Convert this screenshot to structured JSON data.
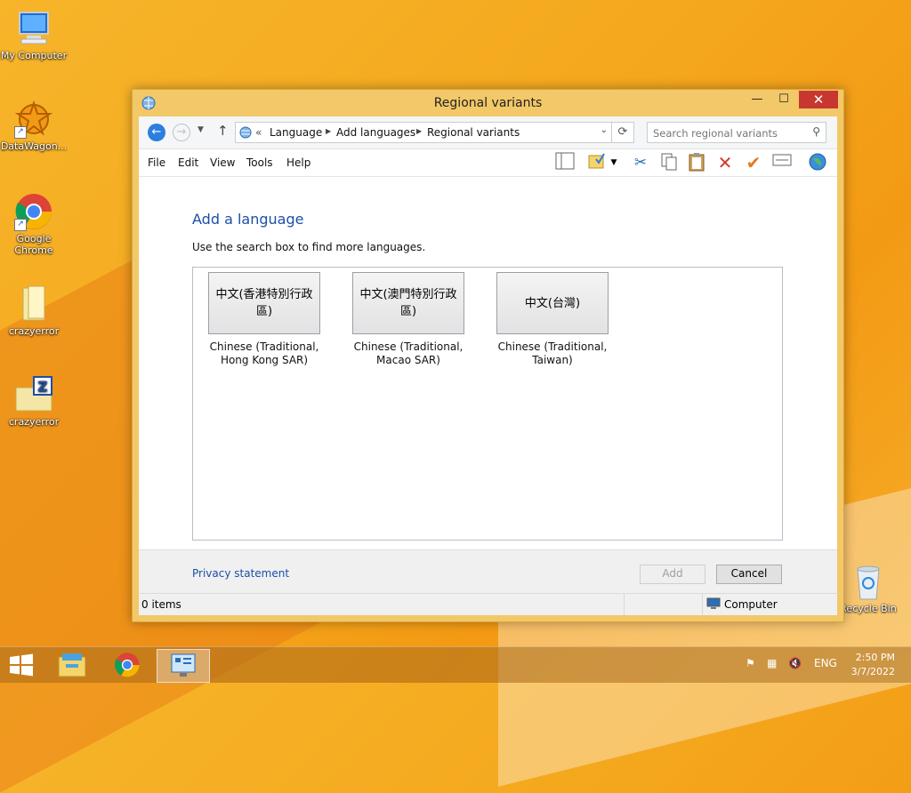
{
  "desktop": {
    "icons": [
      {
        "label": "My Computer",
        "icon": "computer-icon"
      },
      {
        "label": "DataWagon...",
        "icon": "datawagon-icon"
      },
      {
        "label": "Google Chrome",
        "icon": "chrome-icon"
      },
      {
        "label": "crazyerror",
        "icon": "folder-icon"
      },
      {
        "label": "crazyerror",
        "icon": "zip-icon"
      },
      {
        "label": "Recycle Bin",
        "icon": "recycle-bin-icon"
      }
    ]
  },
  "window": {
    "title": "Regional variants",
    "controls": {
      "minimize": "—",
      "maximize": "☐",
      "close": "✕"
    },
    "address": {
      "overflow": "«",
      "crumbs": [
        "Language",
        "Add languages",
        "Regional variants"
      ]
    },
    "search": {
      "placeholder": "Search regional variants"
    },
    "menu": [
      "File",
      "Edit",
      "View",
      "Tools",
      "Help"
    ],
    "toolbar_icons": [
      "layout-pane-icon",
      "folder-check-icon",
      "dropdown-icon",
      "cut-icon",
      "copy-icon",
      "paste-icon",
      "delete-icon",
      "checkmark-icon",
      "properties-icon",
      "globe-icon"
    ],
    "heading": "Add a language",
    "description": "Use the search box to find more languages.",
    "languages": [
      {
        "native": "中文(香港特別行政區)",
        "english": "Chinese (Traditional, Hong Kong SAR)"
      },
      {
        "native": "中文(澳門特別行政區)",
        "english": "Chinese (Traditional, Macao SAR)"
      },
      {
        "native": "中文(台灣)",
        "english": "Chinese (Traditional, Taiwan)"
      }
    ],
    "privacy_link": "Privacy statement",
    "buttons": {
      "add": "Add",
      "cancel": "Cancel"
    },
    "status": {
      "items": "0 items",
      "location": "Computer"
    }
  },
  "taskbar": {
    "apps": [
      "start-icon",
      "file-explorer-icon",
      "chrome-icon",
      "control-panel-icon"
    ],
    "tray": {
      "language": "ENG",
      "time": "2:50 PM",
      "date": "3/7/2022"
    }
  },
  "colors": {
    "accent": "#2c7ee0",
    "link": "#1d4ea8",
    "close": "#c7372f",
    "desktop": "#f4a71d"
  }
}
